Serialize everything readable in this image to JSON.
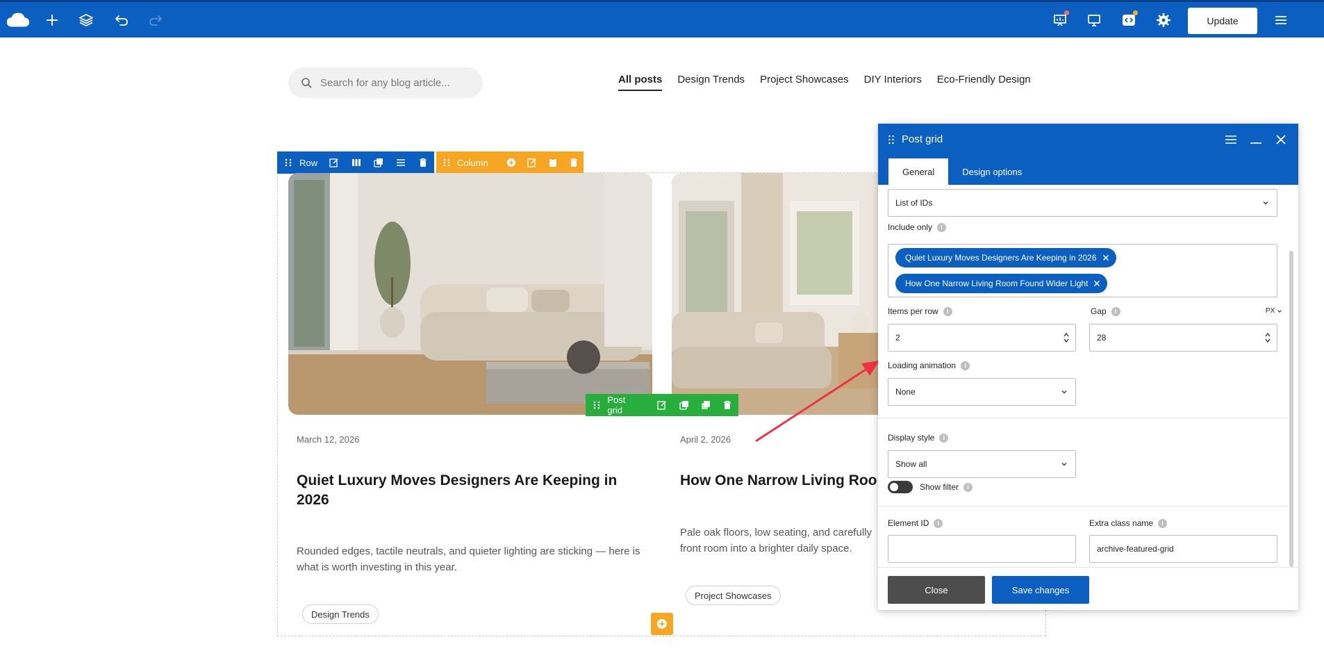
{
  "topbar": {
    "update_label": "Update",
    "icons": [
      "cloud-logo-icon",
      "plus-icon",
      "layers-icon",
      "undo-icon",
      "redo-icon",
      "presentation-icon",
      "monitor-icon",
      "code-icon",
      "gear-icon",
      "hamburger-icon"
    ],
    "colors": {
      "bar": "#0b5fc1"
    }
  },
  "page": {
    "search_placeholder": "Search for any blog article...",
    "categories": [
      "All posts",
      "Design Trends",
      "Project Showcases",
      "DIY Interiors",
      "Eco-Friendly Design"
    ],
    "active_category": "All posts"
  },
  "editor": {
    "row_label": "Row",
    "column_label": "Column",
    "post_grid_label": "Post grid",
    "colors": {
      "row": "#0b5fc1",
      "column": "#f6a623",
      "post_grid": "#27ae3c"
    }
  },
  "posts": [
    {
      "date": "March 12, 2026",
      "title": "Quiet Luxury Moves Designers Are Keeping in 2026",
      "excerpt": "Rounded edges, tactile neutrals, and quieter lighting are sticking — here is what is worth investing in this year.",
      "tag": "Design Trends"
    },
    {
      "date": "April 2, 2026",
      "title": "How One Narrow Living Room",
      "excerpt": "Pale oak floors, low seating, and carefully front room into a brighter daily space.",
      "tag": "Project Showcases"
    }
  ],
  "panel": {
    "title": "Post grid",
    "tabs": [
      "General",
      "Design options"
    ],
    "source_value": "List of IDs",
    "include_only_label": "Include only",
    "included": [
      "Quiet Luxury Moves Designers Are Keeping in 2026",
      "How One Narrow Living Room Found Wider Light"
    ],
    "items_per_row_label": "Items per row",
    "items_per_row": "2",
    "gap_label": "Gap",
    "gap": "28",
    "gap_unit": "PX",
    "loading_animation_label": "Loading animation",
    "loading_animation": "None",
    "display_style_label": "Display style",
    "display_style": "Show all",
    "show_filter_label": "Show filter",
    "element_id_label": "Element ID",
    "element_id": "",
    "extra_class_label": "Extra class name",
    "extra_class": "archive-featured-grid",
    "close_label": "Close",
    "save_label": "Save changes"
  }
}
